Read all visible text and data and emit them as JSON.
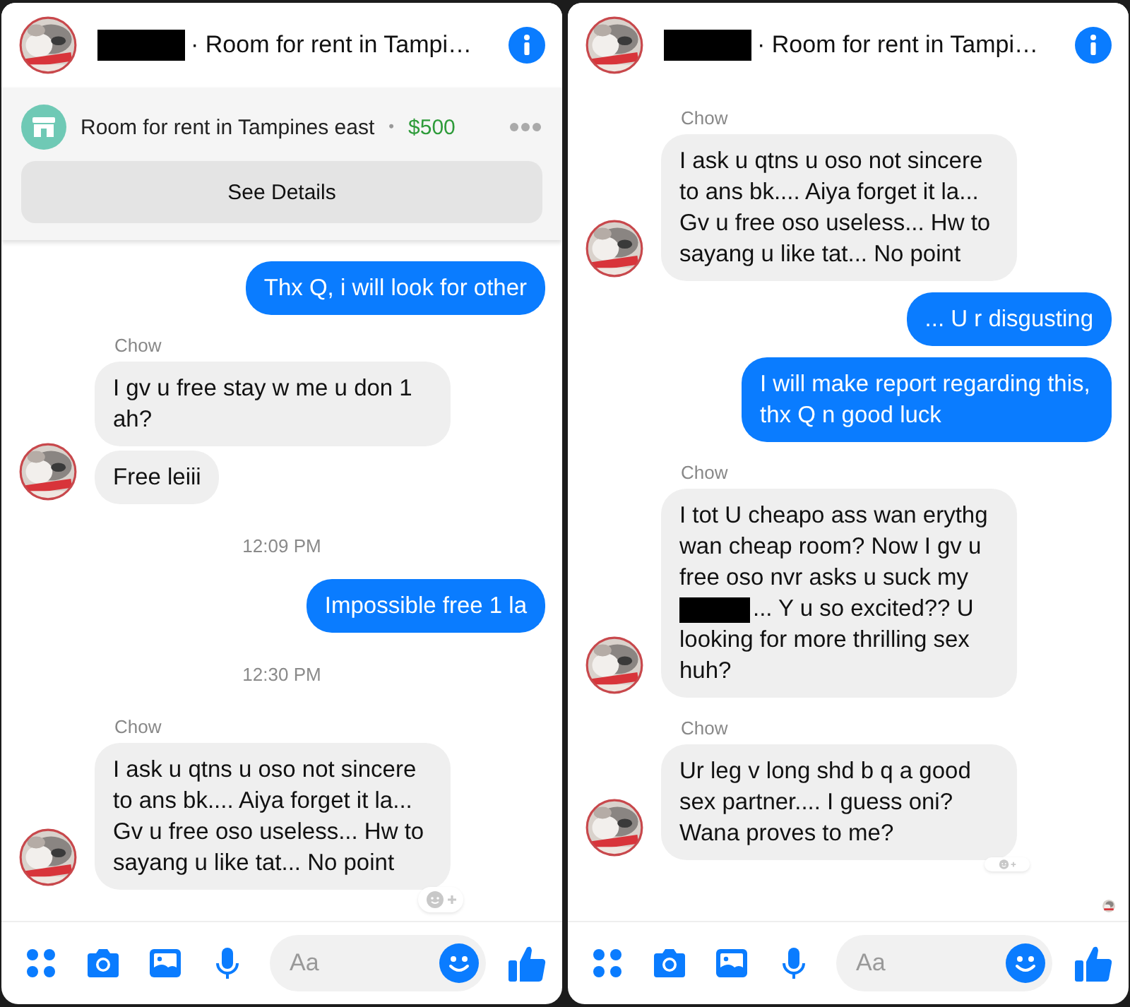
{
  "panels": [
    {
      "header": {
        "title": "· Room for rent in Tampi…"
      },
      "listing": {
        "title": "Room for rent in Tampines east",
        "separator": "•",
        "price": "$500",
        "button": "See Details"
      },
      "messages": [
        {
          "kind": "outgoing",
          "bubbles": [
            {
              "parts": [
                "Thx Q, i will look for other"
              ]
            }
          ]
        },
        {
          "kind": "sender",
          "text": "Chow"
        },
        {
          "kind": "incoming",
          "reaction": false,
          "bubbles": [
            {
              "parts": [
                "I gv u free stay w me u don 1 ah?"
              ]
            },
            {
              "parts": [
                "Free leiii"
              ]
            }
          ]
        },
        {
          "kind": "time",
          "text": "12:09 PM"
        },
        {
          "kind": "outgoing",
          "bubbles": [
            {
              "parts": [
                "Impossible free 1 la"
              ]
            }
          ]
        },
        {
          "kind": "time",
          "text": "12:30 PM"
        },
        {
          "kind": "sender",
          "text": "Chow"
        },
        {
          "kind": "incoming",
          "reaction": true,
          "bubbles": [
            {
              "parts": [
                "I ask u qtns u oso not sincere to ans bk.... Aiya forget it la... Gv u free oso useless... Hw to sayang u like tat... No point"
              ]
            }
          ]
        }
      ],
      "composer": {
        "placeholder": "Aa"
      }
    },
    {
      "header": {
        "title": "· Room for rent in Tampi…"
      },
      "messages": [
        {
          "kind": "sender",
          "text": "Chow"
        },
        {
          "kind": "incoming",
          "reaction": false,
          "bubbles": [
            {
              "parts": [
                "I ask u qtns u oso not sincere to ans bk.... Aiya forget it la... Gv u free oso useless... Hw to sayang u like tat... No point"
              ]
            }
          ]
        },
        {
          "kind": "outgoing",
          "bubbles": [
            {
              "parts": [
                "... U r disgusting"
              ]
            },
            {
              "parts": [
                "I will make report regarding this, thx Q n good luck"
              ]
            }
          ]
        },
        {
          "kind": "sender",
          "text": "Chow"
        },
        {
          "kind": "incoming",
          "reaction": false,
          "bubbles": [
            {
              "parts": [
                "I tot U cheapo ass wan erythg wan cheap room? Now I gv u free oso nvr asks u suck my",
                "... Y u so excited?? U looking for more thrilling sex huh?"
              ]
            }
          ]
        },
        {
          "kind": "sender",
          "text": "Chow"
        },
        {
          "kind": "incoming",
          "reaction": true,
          "bubbles": [
            {
              "parts": [
                "Ur leg v long shd b q a good sex partner.... I guess oni? Wana proves to me?"
              ]
            }
          ]
        },
        {
          "kind": "seen"
        }
      ],
      "composer": {
        "placeholder": "Aa"
      }
    }
  ]
}
